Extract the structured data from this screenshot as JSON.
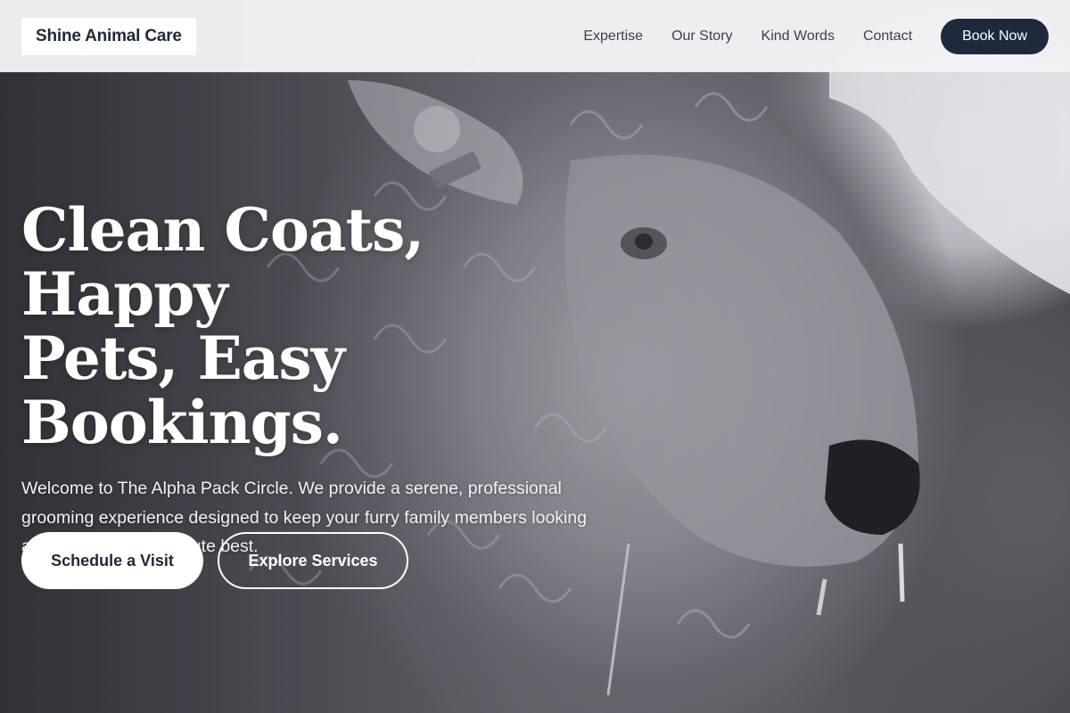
{
  "header": {
    "logo": "Shine Animal Care",
    "nav": [
      "Expertise",
      "Our Story",
      "Kind Words",
      "Contact"
    ],
    "cta": "Book Now"
  },
  "hero": {
    "title_lines": [
      "Clean Coats, Happy",
      "Pets, Easy",
      "Bookings."
    ],
    "description": "Welcome to The Alpha Pack Circle. We provide a serene, professional grooming experience designed to keep your furry family members looking and feeling their absolute best.",
    "primary_button": "Schedule a Visit",
    "secondary_button": "Explore Services"
  },
  "colors": {
    "header_bg": "#f4f4f6",
    "dark_accent": "#1e293b",
    "hero_text": "#ffffff"
  }
}
